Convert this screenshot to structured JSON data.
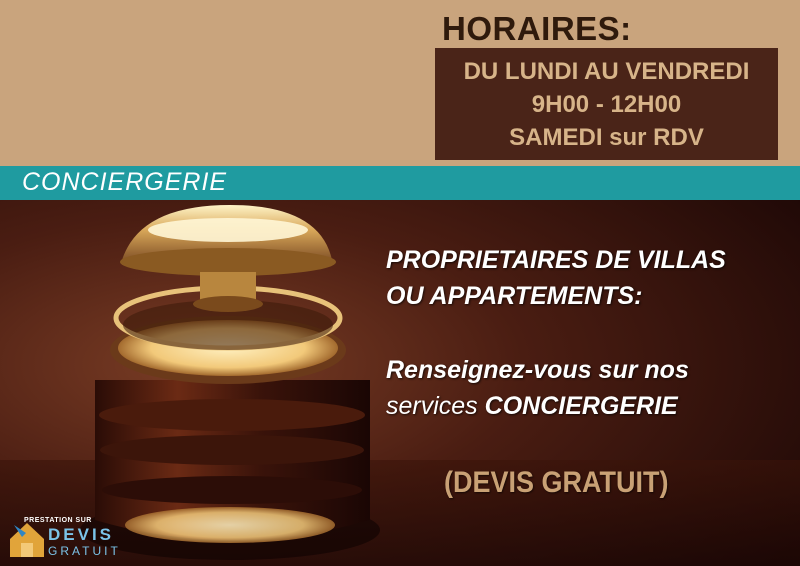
{
  "hours": {
    "title": "HORAIRES:",
    "lines": [
      "DU LUNDI AU VENDREDI",
      "9H00 - 12H00",
      "SAMEDI sur RDV"
    ]
  },
  "section": {
    "title": "CONCIERGERIE"
  },
  "headline": {
    "owners_line1": "PROPRIETAIRES DE VILLAS",
    "owners_line2": "OU APPARTEMENTS:",
    "info_line1": "Renseignez-vous sur nos",
    "info_line2_prefix": "services ",
    "info_line2_emphasis": "CONCIERGERIE"
  },
  "quote": {
    "label": "(DEVIS GRATUIT)"
  },
  "logo": {
    "top": "PRESTATION SUR",
    "main": "DEVIS",
    "sub": "GRATUIT"
  },
  "colors": {
    "top_band": "#c9a47d",
    "hours_box": "#4a2418",
    "teal_band": "#1f9ba0",
    "quote_text": "#c9a175"
  },
  "image": {
    "subject": "reception-service-bell-icon"
  }
}
